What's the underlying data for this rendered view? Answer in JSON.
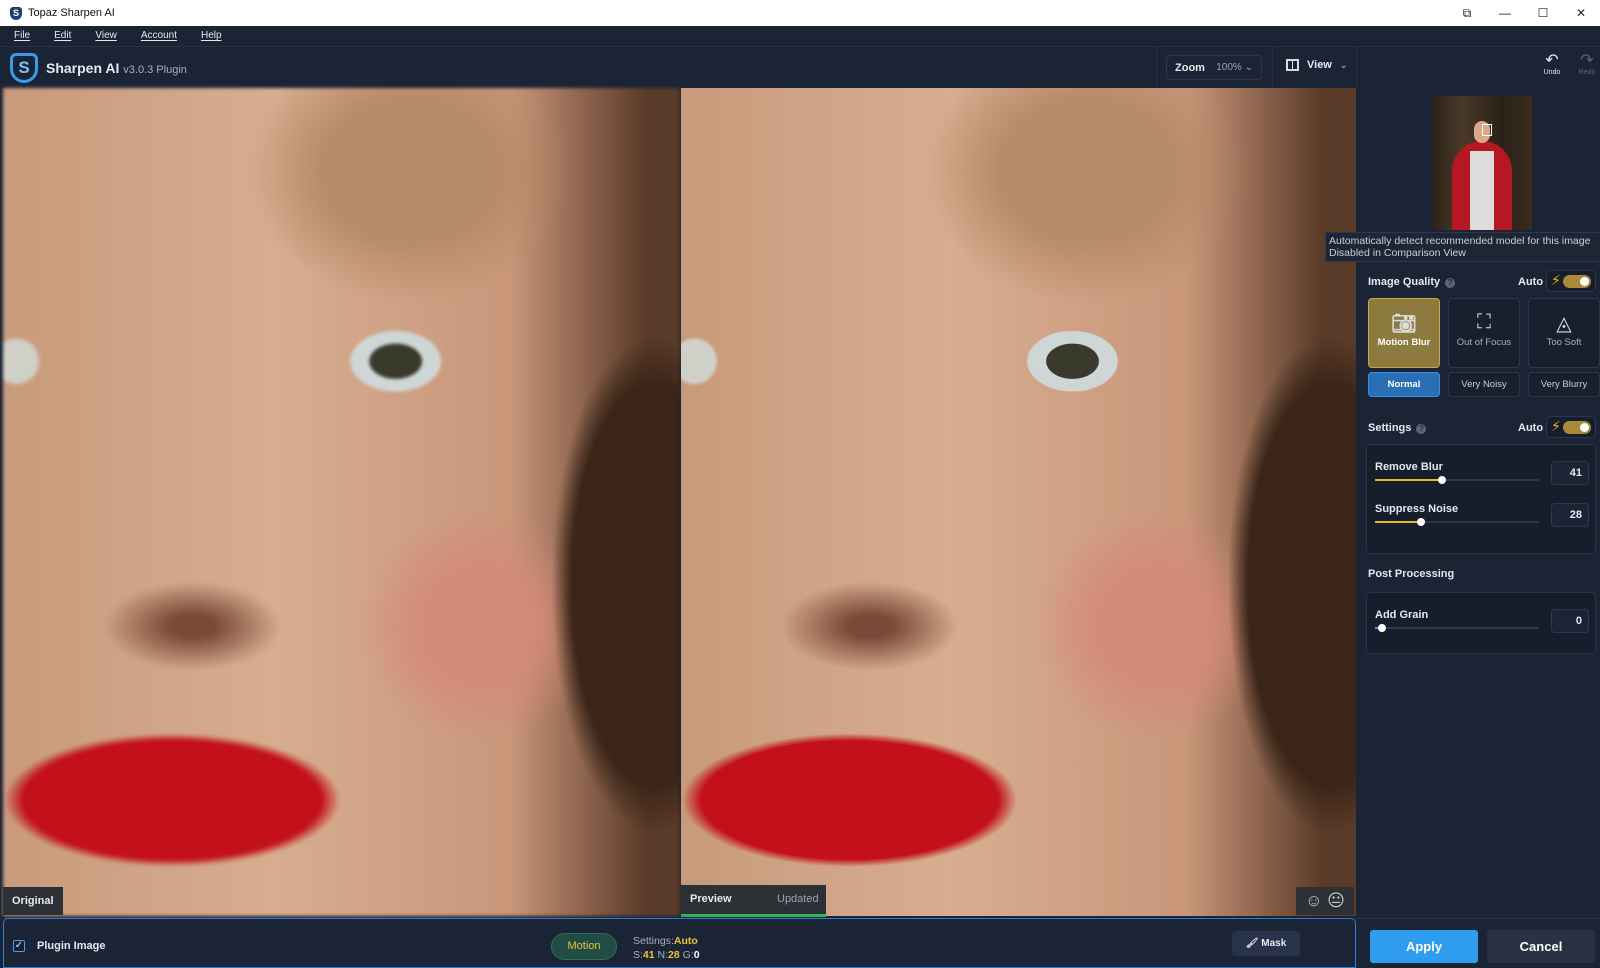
{
  "window": {
    "title": "Topaz Sharpen AI",
    "controls": [
      "minimize",
      "maximize",
      "close"
    ]
  },
  "menu": [
    "File",
    "Edit",
    "View",
    "Account",
    "Help"
  ],
  "header": {
    "app_name": "Sharpen AI",
    "version": "v3.0.3 Plugin",
    "zoom_label": "Zoom",
    "zoom_value": "100%",
    "view_label": "View",
    "undo": "Undo",
    "redo": "Redo"
  },
  "viewer": {
    "left_label": "Original",
    "preview_label": "Preview",
    "updated_label": "Updated"
  },
  "panel": {
    "tooltip_line1": "Automatically detect recommended model for this image",
    "tooltip_line2": "Disabled in Comparison View",
    "image_quality": "Image Quality",
    "auto": "Auto",
    "models": [
      {
        "label": "Motion Blur",
        "selected": true
      },
      {
        "label": "Out of Focus",
        "selected": false
      },
      {
        "label": "Too Soft",
        "selected": false
      }
    ],
    "levels": [
      {
        "label": "Normal",
        "selected": true
      },
      {
        "label": "Very Noisy",
        "selected": false
      },
      {
        "label": "Very Blurry",
        "selected": false
      }
    ],
    "settings": "Settings",
    "remove_blur": {
      "label": "Remove Blur",
      "value": "41"
    },
    "suppress_noise": {
      "label": "Suppress Noise",
      "value": "28"
    },
    "post_processing": "Post Processing",
    "add_grain": {
      "label": "Add Grain",
      "value": "0"
    }
  },
  "bottom": {
    "plugin_image": "Plugin Image",
    "model_badge": "Motion",
    "settings_label": "Settings:",
    "settings_value": "Auto",
    "s_label": "S:",
    "s": "41",
    "n_label": "N:",
    "n": "28",
    "g_label": "G:",
    "g": "0",
    "mask": "Mask",
    "apply": "Apply",
    "cancel": "Cancel"
  },
  "colors": {
    "accent": "#2e9cef",
    "gold": "#e8b820",
    "bg": "#1b2435"
  }
}
